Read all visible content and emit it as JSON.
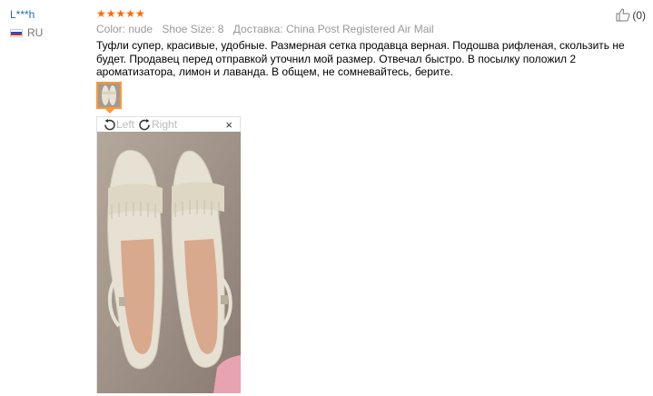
{
  "user": {
    "name": "L***h",
    "country": "RU"
  },
  "review": {
    "stars": "★★★★★",
    "color": "Color: nude",
    "shoe_size": "Shoe Size: 8",
    "shipping": "Доставка: China Post Registered Air Mail",
    "text": "Туфли супер, красивые, удобные. Размерная сетка продавца верная. Подошва рифленая, скользить не будет. Продавец перед отправкой уточнил мой размер. Отвечал быстро. В посылку положил 2 ароматизатора, лимон и лаванда. В общем, не сомневайтесь, берите.",
    "helpful_count": "(0)"
  },
  "viewer": {
    "rotate_left": "Left",
    "rotate_right": "Right",
    "close": "×"
  },
  "colors": {
    "stars": "#ff6a00",
    "link": "#2a6ab5",
    "thumb_border": "#ff9933"
  }
}
